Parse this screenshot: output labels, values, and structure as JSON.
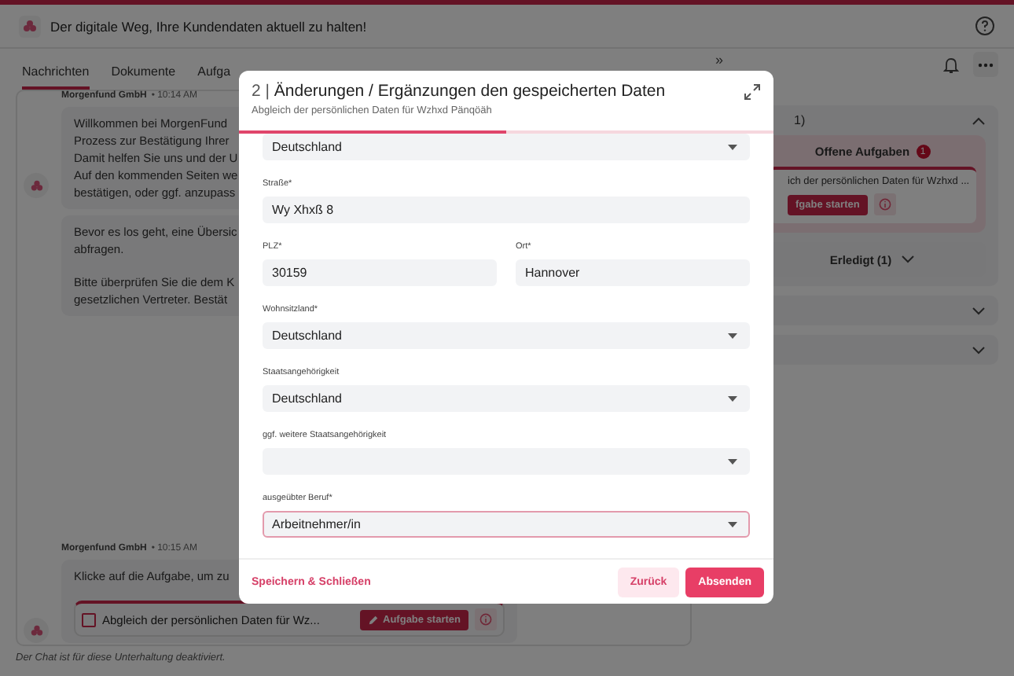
{
  "header": {
    "title": "Der digitale Weg, Ihre Kundendaten aktuell zu halten!"
  },
  "tabs": [
    {
      "label": "Nachrichten",
      "selected": true
    },
    {
      "label": "Dokumente",
      "selected": false
    },
    {
      "label": "Aufga",
      "selected": false
    }
  ],
  "chat": {
    "groups": [
      {
        "sender": "Morgenfund GmbH",
        "time": "• 10:14 AM",
        "bubbles": [
          [
            "Willkommen bei MorgenFund\nProzess zur Bestätigung Ihrer\nDamit helfen Sie uns und der U\nAuf den kommenden Seiten we\nbestätigen, oder ggf. anzupass"
          ],
          [
            "Bevor es los geht, eine Übersic\nabfragen.",
            "Bitte überprüfen Sie die dem K\ngesetzlichen Vertreter. Bestät"
          ]
        ]
      },
      {
        "sender": "Morgenfund GmbH",
        "time": "• 10:15 AM",
        "bubbles": [
          [
            "Klicke auf die Aufgabe, um zu"
          ]
        ],
        "task": {
          "title": "Abgleich der persönlichen Daten für Wz...",
          "checked": false,
          "button": "Aufgabe starten"
        }
      }
    ],
    "note": "Der Chat ist für diese Unterhaltung deaktiviert."
  },
  "side": {
    "collapse": "»",
    "sections": [
      {
        "label": "1)",
        "expanded": true,
        "open_tasks": {
          "label": "Offene Aufgaben",
          "count": "1",
          "task": {
            "title": "ich der persönlichen Daten für Wzhxd ...",
            "button": "fgabe starten"
          }
        },
        "done": {
          "label": "Erledigt (1)",
          "expanded": false
        }
      },
      {
        "expanded": false
      },
      {
        "expanded": false
      }
    ]
  },
  "modal": {
    "step": "2 |",
    "title": "Änderungen / Ergänzungen den gespeicherten Daten",
    "subtitle": "Abgleich der persönlichen Daten für Wzhxd Pänqöäh",
    "progress": {
      "level": 0.5
    },
    "rows": [
      [
        {
          "kind": "select",
          "value": "Deutschland",
          "focused": false
        }
      ],
      [
        {
          "kind": "text",
          "label": "Straße*",
          "value": "Wy Xhxß 8",
          "focused": false
        }
      ],
      [
        {
          "kind": "text",
          "label": "PLZ*",
          "value": "30159",
          "focused": false
        },
        {
          "kind": "text",
          "label": "Ort*",
          "value": "Hannover",
          "focused": false
        }
      ],
      [
        {
          "kind": "select",
          "label": "Wohnsitzland*",
          "value": "Deutschland",
          "focused": false
        }
      ],
      [
        {
          "kind": "select",
          "label": "Staatsangehörigkeit",
          "value": "Deutschland",
          "focused": false
        }
      ],
      [
        {
          "kind": "select",
          "label": "ggf. weitere Staatsangehörigkeit",
          "focused": false
        }
      ],
      [
        {
          "kind": "select",
          "label": "ausgeübter Beruf*",
          "value": "Arbeitnehmer/in",
          "focused": true
        }
      ]
    ],
    "save": "Speichern & Schließen",
    "back": "Zurück",
    "submit": "Absenden"
  }
}
